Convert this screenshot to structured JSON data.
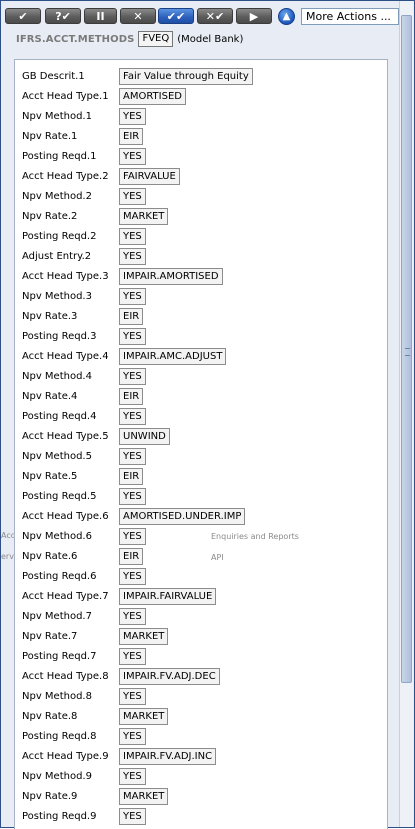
{
  "toolbar": {
    "buttons": [
      {
        "label": "✔",
        "icon": "commit-icon"
      },
      {
        "label": "?✔",
        "icon": "validate-icon"
      },
      {
        "label": "II",
        "icon": "hold-icon"
      },
      {
        "label": "✕",
        "icon": "delete-icon"
      },
      {
        "label": "✔✔",
        "icon": "authorise-icon"
      },
      {
        "label": "✕✔",
        "icon": "reverse-icon"
      },
      {
        "label": "▶",
        "icon": "next-icon"
      }
    ],
    "up_icon": "up-arrow-icon",
    "more_actions": "More Actions ..."
  },
  "heading": {
    "application": "IFRS.ACCT.METHODS",
    "record_id": "FVEQ",
    "description": "(Model Bank)"
  },
  "fields": [
    {
      "label": "GB Descrit.1",
      "value": "Fair Value through Equity"
    },
    {
      "label": "Acct Head Type.1",
      "value": "AMORTISED"
    },
    {
      "label": "Npv Method.1",
      "value": "YES"
    },
    {
      "label": "Npv Rate.1",
      "value": "EIR"
    },
    {
      "label": "Posting Reqd.1",
      "value": "YES"
    },
    {
      "label": "Acct Head Type.2",
      "value": "FAIRVALUE"
    },
    {
      "label": "Npv Method.2",
      "value": "YES"
    },
    {
      "label": "Npv Rate.2",
      "value": "MARKET"
    },
    {
      "label": "Posting Reqd.2",
      "value": "YES"
    },
    {
      "label": "Adjust Entry.2",
      "value": "YES"
    },
    {
      "label": "Acct Head Type.3",
      "value": "IMPAIR.AMORTISED"
    },
    {
      "label": "Npv Method.3",
      "value": "YES"
    },
    {
      "label": "Npv Rate.3",
      "value": "EIR"
    },
    {
      "label": "Posting Reqd.3",
      "value": "YES"
    },
    {
      "label": "Acct Head Type.4",
      "value": "IMPAIR.AMC.ADJUST"
    },
    {
      "label": "Npv Method.4",
      "value": "YES"
    },
    {
      "label": "Npv Rate.4",
      "value": "EIR"
    },
    {
      "label": "Posting Reqd.4",
      "value": "YES"
    },
    {
      "label": "Acct Head Type.5",
      "value": "UNWIND"
    },
    {
      "label": "Npv Method.5",
      "value": "YES"
    },
    {
      "label": "Npv Rate.5",
      "value": "EIR"
    },
    {
      "label": "Posting Reqd.5",
      "value": "YES"
    },
    {
      "label": "Acct Head Type.6",
      "value": "AMORTISED.UNDER.IMP"
    },
    {
      "label": "Npv Method.6",
      "value": "YES"
    },
    {
      "label": "Npv Rate.6",
      "value": "EIR"
    },
    {
      "label": "Posting Reqd.6",
      "value": "YES"
    },
    {
      "label": "Acct Head Type.7",
      "value": "IMPAIR.FAIRVALUE"
    },
    {
      "label": "Npv Method.7",
      "value": "YES"
    },
    {
      "label": "Npv Rate.7",
      "value": "MARKET"
    },
    {
      "label": "Posting Reqd.7",
      "value": "YES"
    },
    {
      "label": "Acct Head Type.8",
      "value": "IMPAIR.FV.ADJ.DEC"
    },
    {
      "label": "Npv Method.8",
      "value": "YES"
    },
    {
      "label": "Npv Rate.8",
      "value": "MARKET"
    },
    {
      "label": "Posting Reqd.8",
      "value": "YES"
    },
    {
      "label": "Acct Head Type.9",
      "value": "IMPAIR.FV.ADJ.INC"
    },
    {
      "label": "Npv Method.9",
      "value": "YES"
    },
    {
      "label": "Npv Rate.9",
      "value": "MARKET"
    },
    {
      "label": "Posting Reqd.9",
      "value": "YES"
    }
  ],
  "background_text": {
    "left_1": "Accounts",
    "left_2": "ervices",
    "mid_1": "Enquiries and Reports",
    "mid_2": "API"
  }
}
